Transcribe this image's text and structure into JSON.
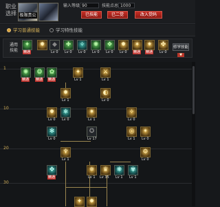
{
  "header": {
    "job_label": "职业选择",
    "portrait_caption": "极限贵公",
    "stats": {
      "level_label": "输入等级",
      "level_value": "90",
      "points_label": "技能点总和",
      "points_value": "1000"
    },
    "buttons": [
      "已技能",
      "已二觉",
      "改入觉码"
    ]
  },
  "tabs": [
    {
      "label": "学习普通技能",
      "selected": true
    },
    {
      "label": "学习特性技能",
      "selected": false
    }
  ],
  "common_skills": {
    "label": "通用技能",
    "icons": [
      {
        "name": "green",
        "tag": "精通"
      },
      {
        "name": "gold",
        "tag": ""
      },
      {
        "name": "dark",
        "tag": "Lv 0"
      },
      {
        "name": "green",
        "tag": "Lv 0"
      },
      {
        "name": "teal",
        "tag": "Lv 0"
      },
      {
        "name": "green",
        "tag": "Lv 0"
      },
      {
        "name": "green",
        "tag": "Lv 0"
      },
      {
        "name": "gold",
        "tag": "Lv 0"
      },
      {
        "name": "gold",
        "tag": "精通"
      },
      {
        "name": "gold",
        "tag": "精通"
      },
      {
        "name": "gold",
        "tag": "Lv 0"
      }
    ],
    "learn_button": "修学技能"
  },
  "tree": {
    "levels": [
      "1",
      "10",
      "20",
      "30"
    ],
    "nodes": [
      {
        "name": "green",
        "tag": "精通"
      },
      {
        "name": "green",
        "tag": "精通"
      },
      {
        "name": "green",
        "tag": "精通"
      },
      {
        "name": "gold",
        "tag": "Lv 1"
      },
      {
        "name": "gold",
        "tag": "Lv 1"
      },
      {
        "name": "gold",
        "tag": "Lv 1"
      },
      {
        "name": "gold",
        "tag": "Lv 0"
      },
      {
        "name": "gold",
        "tag": "Lv 0"
      },
      {
        "name": "teal",
        "tag": "Lv 0"
      },
      {
        "name": "gold",
        "tag": "Lv 1"
      },
      {
        "name": "dark",
        "tag": "Lv 17"
      },
      {
        "name": "gold",
        "tag": "Lv 0"
      },
      {
        "name": "teal",
        "tag": "Lv 0"
      },
      {
        "name": "gold",
        "tag": "Lv 1"
      },
      {
        "name": "gold",
        "tag": "Lv 0"
      },
      {
        "name": "teal",
        "tag": "精通"
      },
      {
        "name": "gold",
        "tag": "Lv 1"
      },
      {
        "name": "gold",
        "tag": "Lv 1"
      },
      {
        "name": "gold",
        "tag": "Lv 35"
      },
      {
        "name": "teal",
        "tag": "Lv 1"
      },
      {
        "name": "teal",
        "tag": "Lv 1"
      },
      {
        "name": "gold",
        "tag": "Lv 0"
      }
    ]
  },
  "colors": {
    "accent_red": "#c62e24",
    "gold": "#d7b25a",
    "bg": "#16181b"
  }
}
